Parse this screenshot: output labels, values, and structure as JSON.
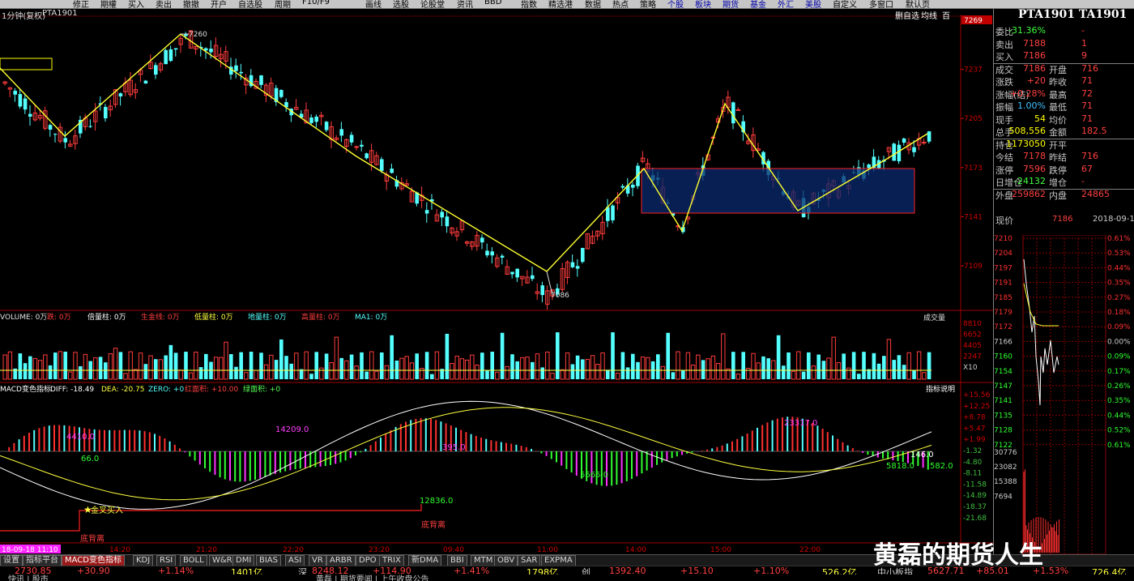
{
  "toolbar": {
    "items": [
      "修正",
      "期權",
      "买入",
      "卖出",
      "撤撤",
      "开户",
      "自选股",
      "周期",
      "F10/F9",
      "画线",
      "选股",
      "论股堂",
      "资讯",
      "BBD",
      "指数",
      "精选港",
      "数据",
      "热点",
      "策略",
      "个股",
      "板块",
      "期货",
      "基金",
      "外汇",
      "美股",
      "自定义",
      "多窗口",
      "默认页"
    ]
  },
  "chart_header": {
    "period": "1分钟(复权)",
    "symbol": "PTA1901",
    "btn_a": "删自选",
    "btn_b": "均线",
    "btn_c": "百"
  },
  "price_axis": [
    "7269",
    "7237",
    "7205",
    "7173",
    "7141",
    "7109"
  ],
  "annotations": {
    "high": "7260",
    "low": "7086"
  },
  "volume_header": {
    "label": "VOLUME: 0万",
    "items": [
      "跌: 0万",
      "倍量柱: 0万",
      "生金线: 0万",
      "低量柱: 0万",
      "地量柱: 0万",
      "高量柱: 0万",
      "MA1: 0万"
    ],
    "dropdown": "成交量"
  },
  "volume_axis": [
    "8810",
    "6652",
    "4405",
    "2247",
    "X10"
  ],
  "macd_header": {
    "title": "MACD变色指标",
    "diff": "DIFF: -18.49",
    "dea": "DEA: -20.75",
    "zero": "ZERO: +0",
    "red": "红面积: +10.00",
    "green": "绿面积: +0",
    "help": "指标说明"
  },
  "macd_axis": [
    "+15.56",
    "+12.25",
    "+8.78",
    "+5.47",
    "+1.99",
    "-1.32",
    "-4.80",
    "-8.11",
    "-11.58",
    "-14.89",
    "-18.37",
    "-21.68"
  ],
  "macd_labels": {
    "a": "4410.0",
    "b": "66.0",
    "c": "14209.0",
    "d": "395.0",
    "e": "12836.0",
    "f": "5665.0",
    "g": "23317.0",
    "h": "146.0",
    "i": "5818.0",
    "j": "582.0",
    "buy": "金叉买入",
    "div1": "底背离",
    "div2": "底背离"
  },
  "time_axis": {
    "cursor": "18-09-18 11:10",
    "ticks": [
      "14:20",
      "21:20",
      "22:20",
      "23:20",
      "09:40",
      "11:00",
      "14:00",
      "15:00",
      "22:00"
    ]
  },
  "right_panel": {
    "title": "PTA1901 TA1901",
    "price_axis_top": "7269",
    "quotes": [
      {
        "k": "委比",
        "v": "-31.36%",
        "c": "#40ff40",
        "k2": "",
        "v2": "-"
      },
      {
        "k": "卖出",
        "v": "7188",
        "c": "#ff4040",
        "k2": "",
        "v2": "1"
      },
      {
        "k": "买入",
        "v": "7186",
        "c": "#ff4040",
        "k2": "",
        "v2": "9"
      },
      {
        "k": "成交",
        "v": "7186",
        "c": "#ff4040",
        "k2": "开盘",
        "v2": "716"
      },
      {
        "k": "涨跌",
        "v": "+20",
        "c": "#ff4040",
        "k2": "昨收",
        "v2": "71"
      },
      {
        "k": "涨幅(结)",
        "v": "+0.28%",
        "c": "#ff4040",
        "k2": "最高",
        "v2": "72"
      },
      {
        "k": "振幅",
        "v": "1.00%",
        "c": "#40c0ff",
        "k2": "最低",
        "v2": "71"
      },
      {
        "k": "现手",
        "v": "54",
        "c": "#ffff00",
        "k2": "均价",
        "v2": "71"
      },
      {
        "k": "总手",
        "v": "508,556",
        "c": "#ffff00",
        "k2": "金额",
        "v2": "182.5"
      },
      {
        "k": "持仓",
        "v": "1173050",
        "c": "#ffff00",
        "k2": "开平",
        "v2": ""
      },
      {
        "k": "今结",
        "v": "7178",
        "c": "#ff4040",
        "k2": "昨结",
        "v2": "716"
      },
      {
        "k": "涨停",
        "v": "7596",
        "c": "#ff4040",
        "k2": "跌停",
        "v2": "67"
      },
      {
        "k": "日增仓",
        "v": "-24132",
        "c": "#40ff40",
        "k2": "增仓",
        "v2": "-"
      },
      {
        "k": "外盘",
        "v": "259862",
        "c": "#ff4040",
        "k2": "内盘",
        "v2": "24865"
      }
    ],
    "current_label": "现价",
    "current_value": "7186",
    "date": "2018-09-19,",
    "mini_axis_left": [
      "7210",
      "7204",
      "7197",
      "7191",
      "7185",
      "7179",
      "7172",
      "7166",
      "7160",
      "7154",
      "7147",
      "7141",
      "7135",
      "7128",
      "7122",
      "30776",
      "23082",
      "15388",
      "7694"
    ],
    "mini_axis_right": [
      "0.61%",
      "0.53%",
      "0.44%",
      "0.35%",
      "0.27%",
      "0.18%",
      "0.09%",
      "0.00%",
      "0.09%",
      "0.17%",
      "0.26%",
      "0.35%",
      "0.44%",
      "0.52%",
      "0.61%"
    ]
  },
  "tabs": [
    "设置",
    "指标平台",
    "MACD变色指标",
    "KDJ",
    "RSI",
    "BOLL",
    "W&R",
    "DMI",
    "BIAS",
    "ASI",
    "VR",
    "ARBR",
    "DPO",
    "TRIX",
    "新DMA",
    "BBI",
    "MTM",
    "OBV",
    "SAR",
    "EXPMA"
  ],
  "index_bar": [
    "2730.85",
    "+30.90",
    "+1.14%",
    "1401亿",
    "深",
    "8248.12",
    "+114.90",
    "+1.41%",
    "1798亿",
    "创",
    "1392.40",
    "+15.10",
    "+1.10%",
    "526.2亿",
    "中小板指",
    "5627.71",
    "+85.01",
    "+1.53%",
    "726.4亿"
  ],
  "ticker": [
    "快讯 | 股市",
    "黄磊 | 期货要闻 | 上午收盘公告"
  ],
  "watermark": "黄磊的期货人生"
}
